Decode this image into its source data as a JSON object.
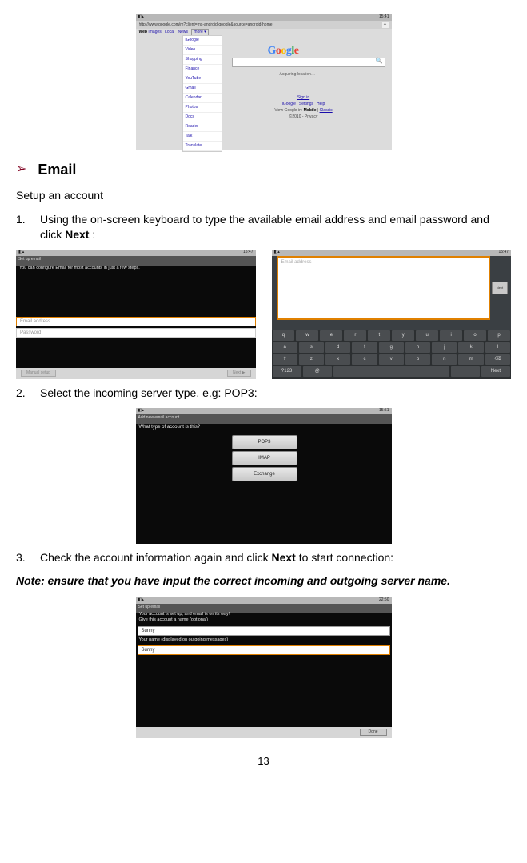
{
  "google_shot": {
    "time": "15:41",
    "url": "http://www.google.com/m?client=ms-android-google&source=android-home",
    "nav_web": "Web",
    "nav_images": "Images",
    "nav_local": "Local",
    "nav_news": "News",
    "nav_more": "more ▾",
    "sidebar": [
      "iGoogle",
      "Video",
      "Shopping",
      "Finance",
      "YouTube",
      "Gmail",
      "Calendar",
      "Photos",
      "Docs",
      "Reader",
      "Talk",
      "Translate"
    ],
    "loc": "Acquiring location…",
    "links_row1_signin": "Sign in",
    "links_row1_google": "iGoogle",
    "links_row1_settings": "Settings",
    "links_row1_help": "Help",
    "links_row2_pre": "View Google in:",
    "links_row2_mobile": "Mobile",
    "links_row2_classic": "Classic",
    "links_row3": "©2010 - Privacy"
  },
  "heading": "Email",
  "intro": "Setup an account",
  "step1": {
    "num": "1.",
    "text_pre": "Using the on-screen keyboard to type the available email address and email password and click ",
    "bold": "Next",
    "text_post": " :"
  },
  "email_left": {
    "time": "15:47",
    "title": "Set up email",
    "msg": "You can configure Email for most accounts in just a few steps.",
    "field1": "Email address",
    "field2": "Password",
    "btn_left": "Manual setup",
    "btn_right": "Next ▶"
  },
  "email_right": {
    "time": "15:47",
    "field": "Email address",
    "next": "Next",
    "kb_r1": [
      "q",
      "w",
      "e",
      "r",
      "t",
      "y",
      "u",
      "i",
      "o",
      "p"
    ],
    "kb_r2": [
      "a",
      "s",
      "d",
      "f",
      "g",
      "h",
      "j",
      "k",
      "l"
    ],
    "kb_r3": [
      "⇧",
      "z",
      "x",
      "c",
      "v",
      "b",
      "n",
      "m",
      "⌫"
    ],
    "kb_r4_123": "?123",
    "kb_r4_at": "@",
    "kb_r4_space": "",
    "kb_r4_dot": ".",
    "kb_r4_next": "Next"
  },
  "step2": {
    "num": "2.",
    "text": "Select the incoming server type, e.g: POP3:"
  },
  "pop_shot": {
    "time": "15:51",
    "title": "Add new email account",
    "question": "What type of account is this?",
    "b1": "POP3",
    "b2": "IMAP",
    "b3": "Exchange"
  },
  "step3": {
    "num": "3.",
    "text_pre": "Check the account information again and click ",
    "bold": "Next",
    "text_post": " to start connection:"
  },
  "note": "Note: ensure that you have input the correct incoming and outgoing server name.",
  "acct_shot": {
    "time": "22:50",
    "title": "Set up email",
    "msg1": "Your account is set up, and email is on its way!",
    "msg2": "Give this account a name (optional)",
    "field1": "Sunny",
    "label2": "Your name (displayed on outgoing messages)",
    "field2": "Sunny",
    "btn": "Done"
  },
  "page_num": "13"
}
